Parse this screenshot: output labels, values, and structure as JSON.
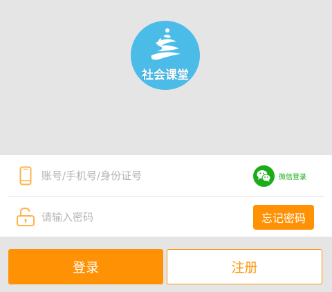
{
  "app": {
    "logo_text": "社会课堂"
  },
  "login_form": {
    "account_placeholder": "账号/手机号/身份证号",
    "password_placeholder": "请输入密码",
    "wechat_login_label": "微信登录",
    "forgot_password_label": "忘记密码"
  },
  "actions": {
    "login_label": "登录",
    "register_label": "注册"
  },
  "colors": {
    "accent": "#ff9204",
    "logo_blue": "#4bbbe8",
    "wechat_green": "#1aad19",
    "background": "#e5e5e5"
  },
  "icons": {
    "account": "phone-icon",
    "password": "lock-icon",
    "wechat": "wechat-icon"
  }
}
